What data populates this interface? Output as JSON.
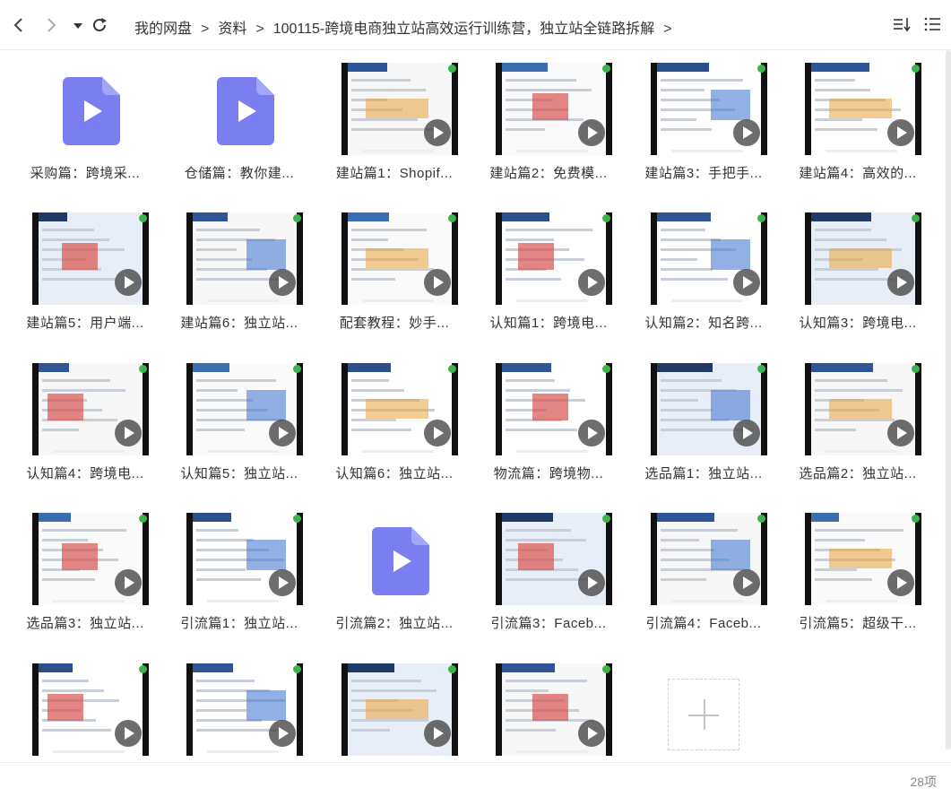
{
  "breadcrumb": {
    "items": [
      "我的网盘",
      "资料",
      "100115-跨境电商独立站高效运行训练营，独立站全链路拆解"
    ],
    "separator": ">",
    "trailing": ">"
  },
  "files": [
    {
      "label": "采购篇：跨境采...",
      "kind": "videofile"
    },
    {
      "label": "仓储篇：教你建...",
      "kind": "videofile"
    },
    {
      "label": "建站篇1：Shopif...",
      "kind": "thumb"
    },
    {
      "label": "建站篇2：免费模...",
      "kind": "thumb"
    },
    {
      "label": "建站篇3：手把手...",
      "kind": "thumb"
    },
    {
      "label": "建站篇4：高效的...",
      "kind": "thumb"
    },
    {
      "label": "建站篇5：用户端...",
      "kind": "thumb"
    },
    {
      "label": "建站篇6：独立站...",
      "kind": "thumb"
    },
    {
      "label": "配套教程：妙手...",
      "kind": "thumb"
    },
    {
      "label": "认知篇1：跨境电...",
      "kind": "thumb"
    },
    {
      "label": "认知篇2：知名跨...",
      "kind": "thumb"
    },
    {
      "label": "认知篇3：跨境电...",
      "kind": "thumb"
    },
    {
      "label": "认知篇4：跨境电...",
      "kind": "thumb"
    },
    {
      "label": "认知篇5：独立站...",
      "kind": "thumb"
    },
    {
      "label": "认知篇6：独立站...",
      "kind": "thumb"
    },
    {
      "label": "物流篇：跨境物...",
      "kind": "thumb"
    },
    {
      "label": "选品篇1：独立站...",
      "kind": "thumb"
    },
    {
      "label": "选品篇2：独立站...",
      "kind": "thumb"
    },
    {
      "label": "选品篇3：独立站...",
      "kind": "thumb"
    },
    {
      "label": "引流篇1：独立站...",
      "kind": "thumb"
    },
    {
      "label": "引流篇2：独立站...",
      "kind": "videofile"
    },
    {
      "label": "引流篇3：Faceb...",
      "kind": "thumb"
    },
    {
      "label": "引流篇4：Faceb...",
      "kind": "thumb"
    },
    {
      "label": "引流篇5：超级干...",
      "kind": "thumb"
    },
    {
      "label": "",
      "kind": "thumb"
    },
    {
      "label": "",
      "kind": "thumb"
    },
    {
      "label": "",
      "kind": "thumb"
    },
    {
      "label": "",
      "kind": "thumb"
    }
  ],
  "footer": {
    "count": "28项"
  },
  "colors": {
    "videofile": "#7b7ef0",
    "accent_blue": "#2f5597"
  }
}
